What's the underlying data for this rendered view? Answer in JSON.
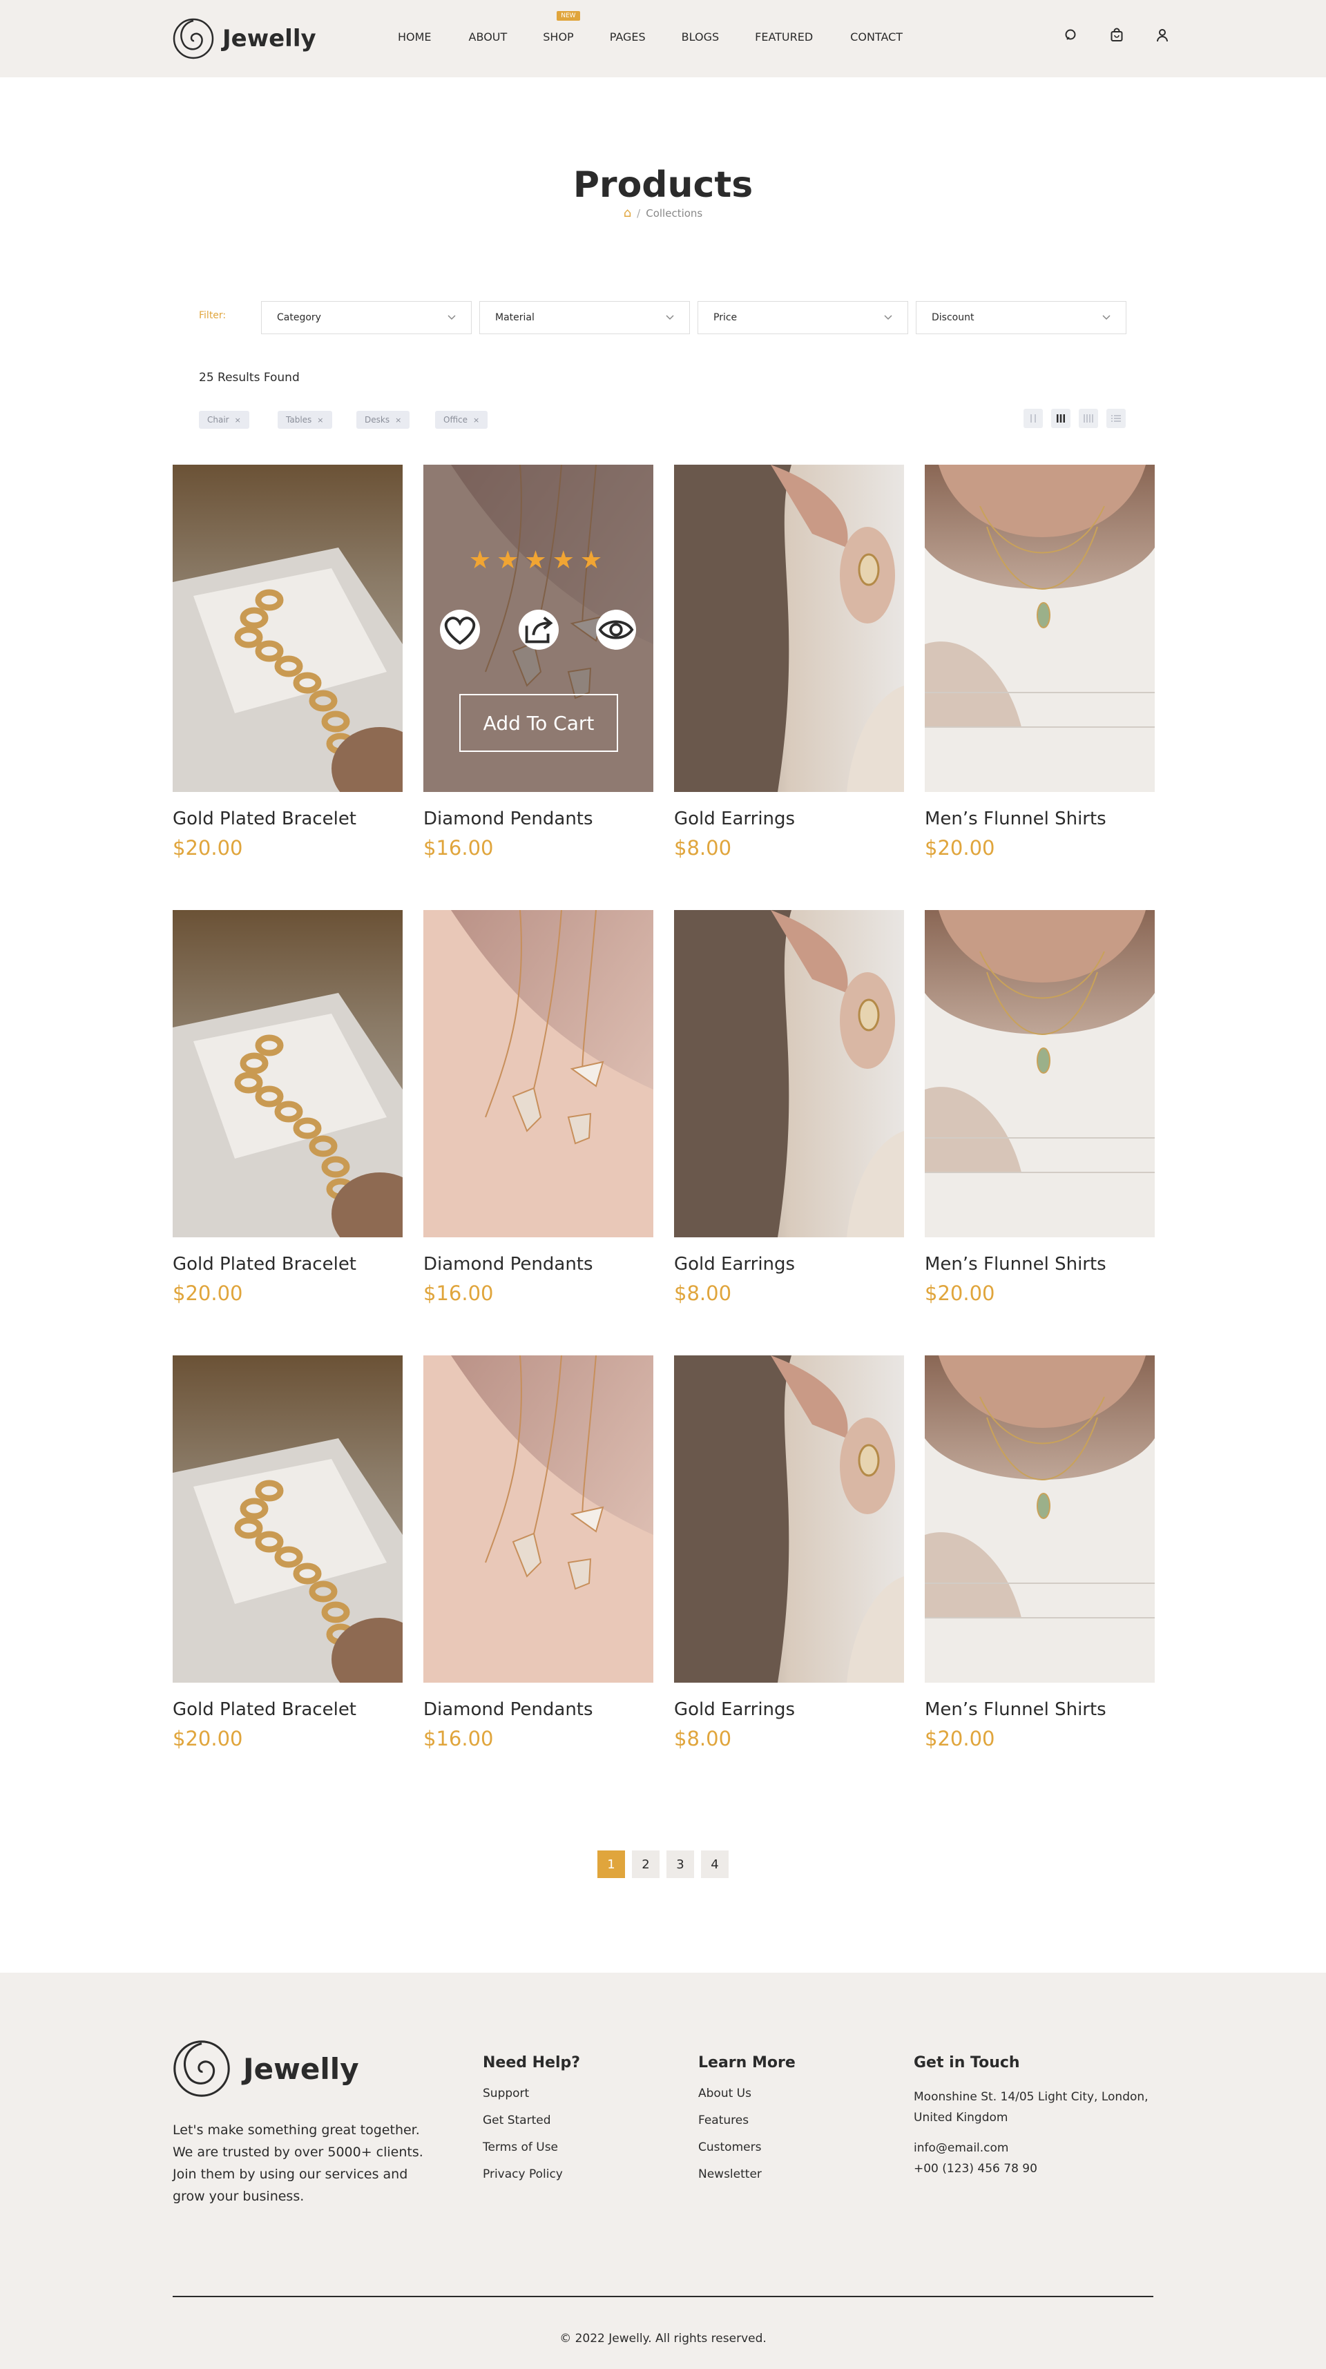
{
  "brand": {
    "name": "Jewelly",
    "accent": "#e0a53c"
  },
  "nav": {
    "items": [
      {
        "label": "HOME"
      },
      {
        "label": "ABOUT"
      },
      {
        "label": "SHOP",
        "badge": "New"
      },
      {
        "label": "PAGES"
      },
      {
        "label": "BLOGS"
      },
      {
        "label": "FEATURED"
      },
      {
        "label": "CONTACT"
      }
    ],
    "icons": [
      "search-icon",
      "cart-icon",
      "user-icon"
    ]
  },
  "page": {
    "title": "Products",
    "breadcrumb": {
      "home_icon": "home-icon",
      "separator": "/",
      "current": "Collections"
    }
  },
  "filter": {
    "label": "Filter:",
    "dropdowns": [
      "Category",
      "Material",
      "Price",
      "Discount"
    ]
  },
  "results": {
    "text": "25 Results Found",
    "tags": [
      {
        "label": "Chair",
        "remove": "×"
      },
      {
        "label": "Tables",
        "remove": "×"
      },
      {
        "label": "Desks",
        "remove": "×"
      },
      {
        "label": "Office",
        "remove": "×"
      }
    ],
    "view_icons": [
      "grid-2-icon",
      "grid-3-icon",
      "grid-4-icon",
      "list-view-icon"
    ]
  },
  "products": [
    {
      "name": "Gold Plated Bracelet",
      "price": "$20.00"
    },
    {
      "name": "Diamond Pendants",
      "price": "$16.00"
    },
    {
      "name": "Gold Earrings",
      "price": "$8.00"
    },
    {
      "name": "Men’s Flunnel Shirts",
      "price": "$20.00"
    },
    {
      "name": "Gold Plated Bracelet",
      "price": "$20.00"
    },
    {
      "name": "Diamond Pendants",
      "price": "$16.00"
    },
    {
      "name": "Gold Earrings",
      "price": "$8.00"
    },
    {
      "name": "Men’s Flunnel Shirts",
      "price": "$20.00"
    },
    {
      "name": "Gold Plated Bracelet",
      "price": "$20.00"
    },
    {
      "name": "Diamond Pendants",
      "price": "$16.00"
    },
    {
      "name": "Gold Earrings",
      "price": "$8.00"
    },
    {
      "name": "Men’s Flunnel Shirts",
      "price": "$20.00"
    }
  ],
  "hover_card": {
    "stars": "★★★★★",
    "rating": 5,
    "actions": [
      "heart-icon",
      "share-icon",
      "eye-icon"
    ],
    "add_to_cart": "Add To Cart"
  },
  "pagination": {
    "pages": [
      "1",
      "2",
      "3",
      "4"
    ],
    "current": "1"
  },
  "footer": {
    "about": "Let's make something great together. We are trusted by over 5000+ clients. Join them by using our services and grow your business.",
    "need_help": {
      "title": "Need Help?",
      "links": [
        "Support",
        "Get Started",
        "Terms of Use",
        "Privacy Policy"
      ]
    },
    "learn_more": {
      "title": "Learn More",
      "links": [
        "About Us",
        "Features",
        "Customers",
        "Newsletter"
      ]
    },
    "contact": {
      "title": "Get in Touch",
      "address": "Moonshine St. 14/05 Light City, London, United Kingdom",
      "email": "info@email.com",
      "phone": "+00 (123) 456 78 90"
    },
    "copyright": "© 2022 Jewelly. All rights reserved."
  }
}
